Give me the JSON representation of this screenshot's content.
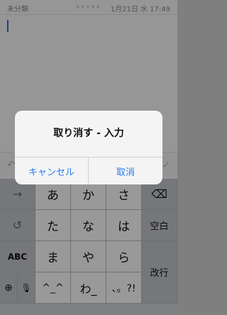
{
  "editor": {
    "category": "未分類",
    "stars": "★★★★★",
    "date_time": "1月21日 水 17:49"
  },
  "accessory": {
    "left_glyph": "↶",
    "right_glyph": "✓"
  },
  "keyboard": {
    "rows": [
      [
        "→",
        "あ",
        "か",
        "さ",
        "⌫"
      ],
      [
        "↺",
        "た",
        "な",
        "は",
        "空白"
      ],
      [
        "ABC",
        "ま",
        "や",
        "ら",
        ""
      ],
      [
        "🌐",
        "🎤",
        "^_^",
        "わ_",
        "、。?!",
        "改行"
      ]
    ],
    "labels": {
      "arrow": "→",
      "undo": "↺",
      "abc": "ABC",
      "space": "空白",
      "enter": "改行",
      "globe": "⊕",
      "mic": "🎙",
      "emoticon": "^_^",
      "wa": "わ_",
      "punct": "、。?!",
      "backspace": "⌫"
    }
  },
  "dialog": {
    "title": "取り消す - 入力",
    "cancel_label": "キャンセル",
    "confirm_label": "取消"
  }
}
